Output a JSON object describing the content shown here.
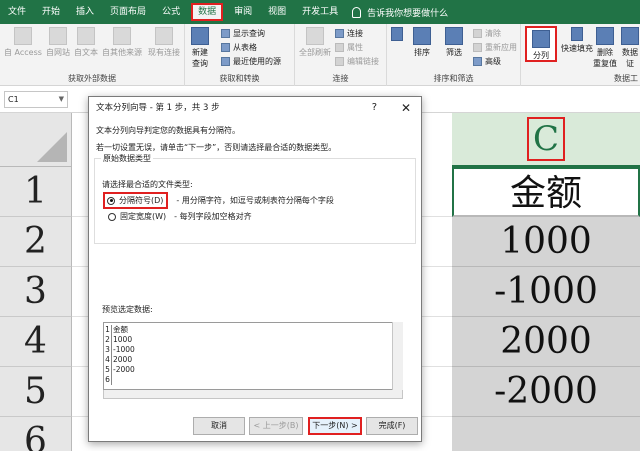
{
  "menu": {
    "tabs": [
      "文件",
      "开始",
      "插入",
      "页面布局",
      "公式",
      "数据",
      "审阅",
      "视图",
      "开发工具"
    ],
    "active_tab": "数据",
    "tell_me": "告诉我你想要做什么"
  },
  "ribbon": {
    "groups": {
      "external": "获取外部数据",
      "transform": "获取和转换",
      "connections": "连接",
      "sort_filter": "排序和筛选",
      "data_tools": "数据工"
    },
    "buttons": {
      "from_access": "自 Access",
      "from_web": "自网站",
      "from_text": "自文本",
      "from_other": "自其他来源",
      "existing": "现有连接",
      "new_query_1": "新建",
      "new_query_2": "查询",
      "refresh_all": "全部刷新",
      "sort": "排序",
      "filter": "筛选",
      "split": "分列",
      "flash_fill": "快速填充",
      "remove_dup_1": "删除",
      "remove_dup_2": "重复值",
      "validate_1": "数据",
      "validate_2": "证"
    },
    "small": {
      "show_queries": "显示查询",
      "from_table": "从表格",
      "recent_sources": "最近使用的源",
      "connections": "连接",
      "properties": "属性",
      "edit_links": "编辑链接",
      "clear": "清除",
      "reapply": "重新应用",
      "advanced": "高级"
    }
  },
  "namebox": {
    "value": "C1"
  },
  "sheet": {
    "col_c": "C",
    "rows": [
      "1",
      "2",
      "3",
      "4",
      "5",
      "6"
    ],
    "col_c_values": [
      "金额",
      "1000",
      "-1000",
      "2000",
      "-2000",
      ""
    ]
  },
  "dialog": {
    "title": "文本分列向导 - 第 1 步，共 3 步",
    "help": "?",
    "close": "✕",
    "intro": "文本分列向导判定您的数据具有分隔符。",
    "hint": "若一切设置无误，请单击“下一步”，否则请选择最合适的数据类型。",
    "group_label": "原始数据类型",
    "choose_label": "请选择最合适的文件类型:",
    "option_delim": "分隔符号(D)",
    "option_delim_desc": "- 用分隔字符，如逗号或制表符分隔每个字段",
    "option_fixed": "固定宽度(W)",
    "option_fixed_desc": "- 每列字段加空格对齐",
    "preview_label": "预览选定数据:",
    "preview_rows": [
      {
        "num": "1",
        "text": "金额"
      },
      {
        "num": "2",
        "text": "1000"
      },
      {
        "num": "3",
        "text": "-1000"
      },
      {
        "num": "4",
        "text": "2000"
      },
      {
        "num": "5",
        "text": "-2000"
      },
      {
        "num": "6",
        "text": ""
      }
    ],
    "buttons": {
      "cancel": "取消",
      "back": "< 上一步(B)",
      "next": "下一步(N) >",
      "finish": "完成(F)"
    }
  },
  "colors": {
    "excel_green": "#217346",
    "highlight_red": "#e02020"
  }
}
